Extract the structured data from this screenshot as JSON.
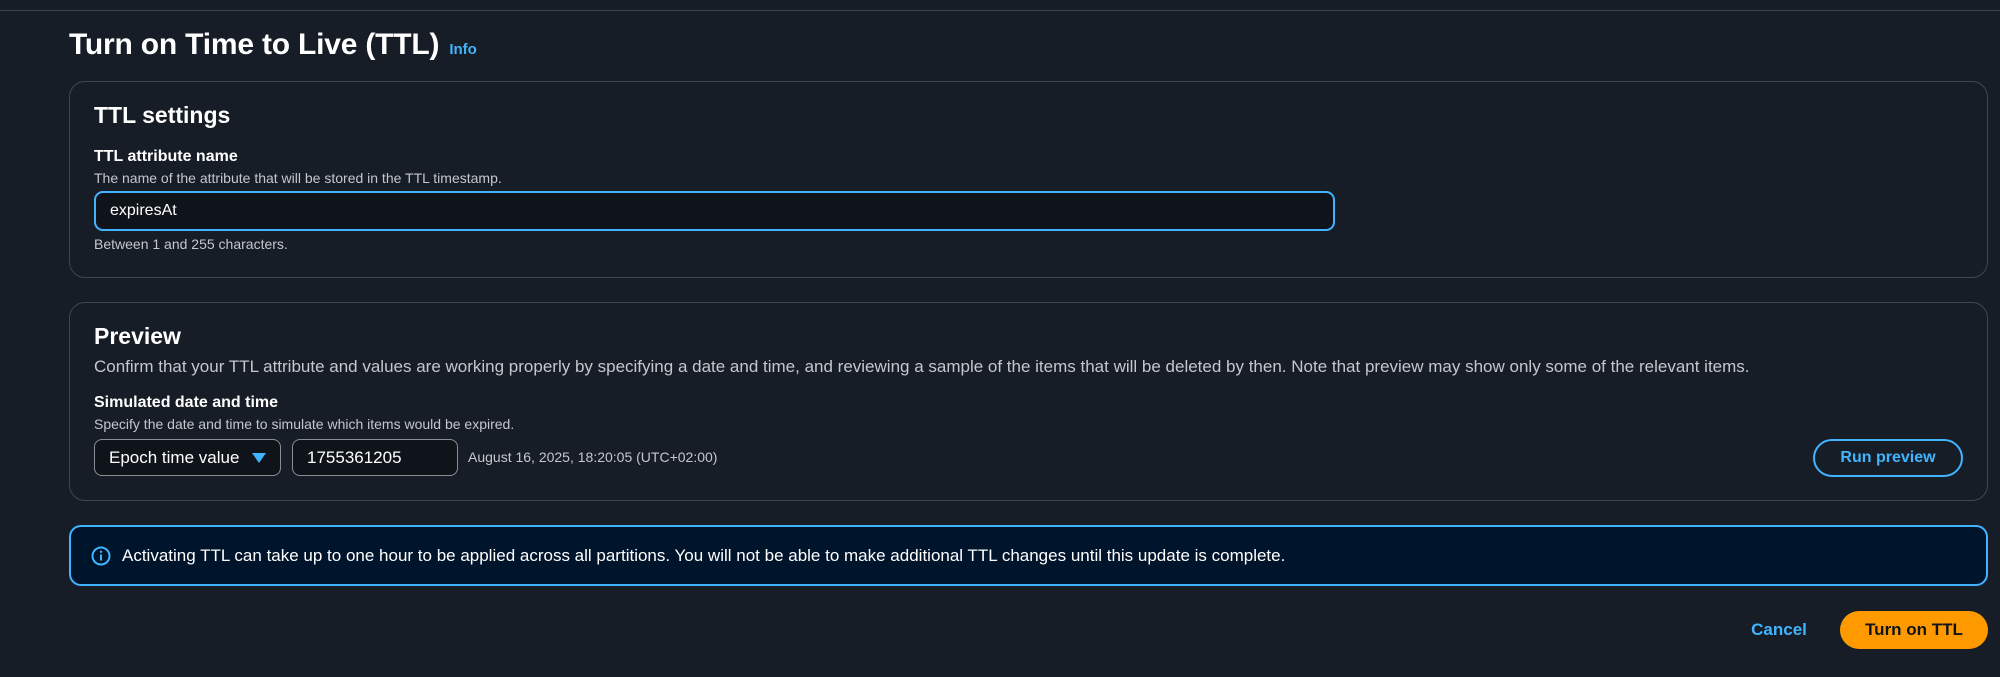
{
  "page": {
    "title": "Turn on Time to Live (TTL)",
    "info_label": "Info"
  },
  "ttl_settings": {
    "heading": "TTL settings",
    "attribute_label": "TTL attribute name",
    "attribute_description": "The name of the attribute that will be stored in the TTL timestamp.",
    "attribute_value": "expiresAt",
    "attribute_hint": "Between 1 and 255 characters."
  },
  "preview": {
    "heading": "Preview",
    "description": "Confirm that your TTL attribute and values are working properly by specifying a date and time, and reviewing a sample of the items that will be deleted by then. Note that preview may show only some of the relevant items.",
    "simulated_label": "Simulated date and time",
    "simulated_description": "Specify the date and time to simulate which items would be expired.",
    "format_selected": "Epoch time value",
    "epoch_value": "1755361205",
    "date_readout": "August 16, 2025, 18:20:05 (UTC+02:00)",
    "run_preview_label": "Run preview"
  },
  "alert": {
    "icon": "info-circle-icon",
    "text": "Activating TTL can take up to one hour to be applied across all partitions. You will not be able to make additional TTL changes until this update is complete."
  },
  "actions": {
    "cancel_label": "Cancel",
    "primary_label": "Turn on TTL"
  },
  "colors": {
    "background": "#161d26",
    "accent_link": "#42b4ff",
    "primary_button": "#ff9900",
    "alert_background": "#00142b"
  }
}
